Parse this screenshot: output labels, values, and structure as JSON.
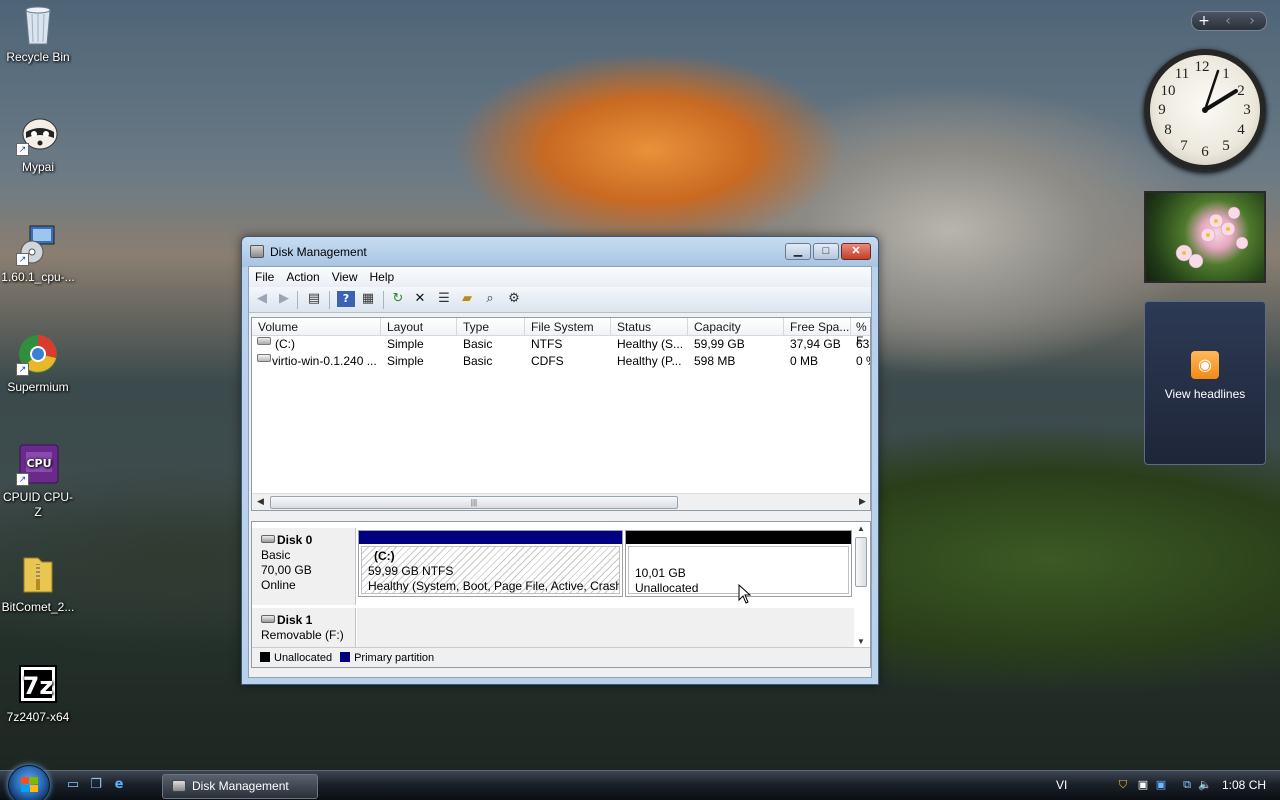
{
  "desktop": {
    "icons": [
      {
        "label": "Recycle Bin",
        "icon": "recycle-bin-icon"
      },
      {
        "label": "Mypai",
        "icon": "raccoon-icon"
      },
      {
        "label": "1.60.1_cpu-...",
        "icon": "installer-icon"
      },
      {
        "label": "Supermium",
        "icon": "supermium-icon"
      },
      {
        "label": "CPUID CPU-Z",
        "icon": "cpuz-icon"
      },
      {
        "label": "BitComet_2...",
        "icon": "zip-folder-icon"
      },
      {
        "label": "7z2407-x64",
        "icon": "7zip-icon"
      }
    ]
  },
  "gadgets": {
    "bar_buttons": [
      "+",
      "‹",
      "›"
    ],
    "clock_numbers": [
      "12",
      "1",
      "2",
      "3",
      "4",
      "5",
      "6",
      "7",
      "8",
      "9",
      "10",
      "11"
    ],
    "feed_text": "View headlines"
  },
  "window": {
    "title": "Disk Management",
    "menu": [
      "File",
      "Action",
      "View",
      "Help"
    ],
    "volume_list": {
      "columns": [
        "Volume",
        "Layout",
        "Type",
        "File System",
        "Status",
        "Capacity",
        "Free Spa...",
        "% F"
      ],
      "rows": [
        [
          "(C:)",
          "Simple",
          "Basic",
          "NTFS",
          "Healthy (S...",
          "59,99 GB",
          "37,94 GB",
          "63"
        ],
        [
          "virtio-win-0.1.240 ...",
          "Simple",
          "Basic",
          "CDFS",
          "Healthy (P...",
          "598 MB",
          "0 MB",
          "0 %"
        ]
      ],
      "scroll_grip": "|||"
    },
    "disks": [
      {
        "name": "Disk 0",
        "type": "Basic",
        "size": "70,00 GB",
        "state": "Online",
        "partitions": [
          {
            "title": "(C:)",
            "size": "59,99 GB NTFS",
            "status": "Healthy (System, Boot, Page File, Active, Crash D"
          },
          {
            "size": "10,01 GB",
            "status": "Unallocated"
          }
        ]
      },
      {
        "name": "Disk 1",
        "type": "Removable (F:)"
      }
    ],
    "legend": [
      {
        "label": "Unallocated",
        "color": "#000000"
      },
      {
        "label": "Primary partition",
        "color": "#000080"
      }
    ]
  },
  "taskbar": {
    "task_button": "Disk Management",
    "language": "VI",
    "time": "1:08 CH"
  },
  "colors": {
    "primary_partition": "#000080",
    "unallocated": "#000000",
    "titlebar": "#b9d1ea"
  }
}
